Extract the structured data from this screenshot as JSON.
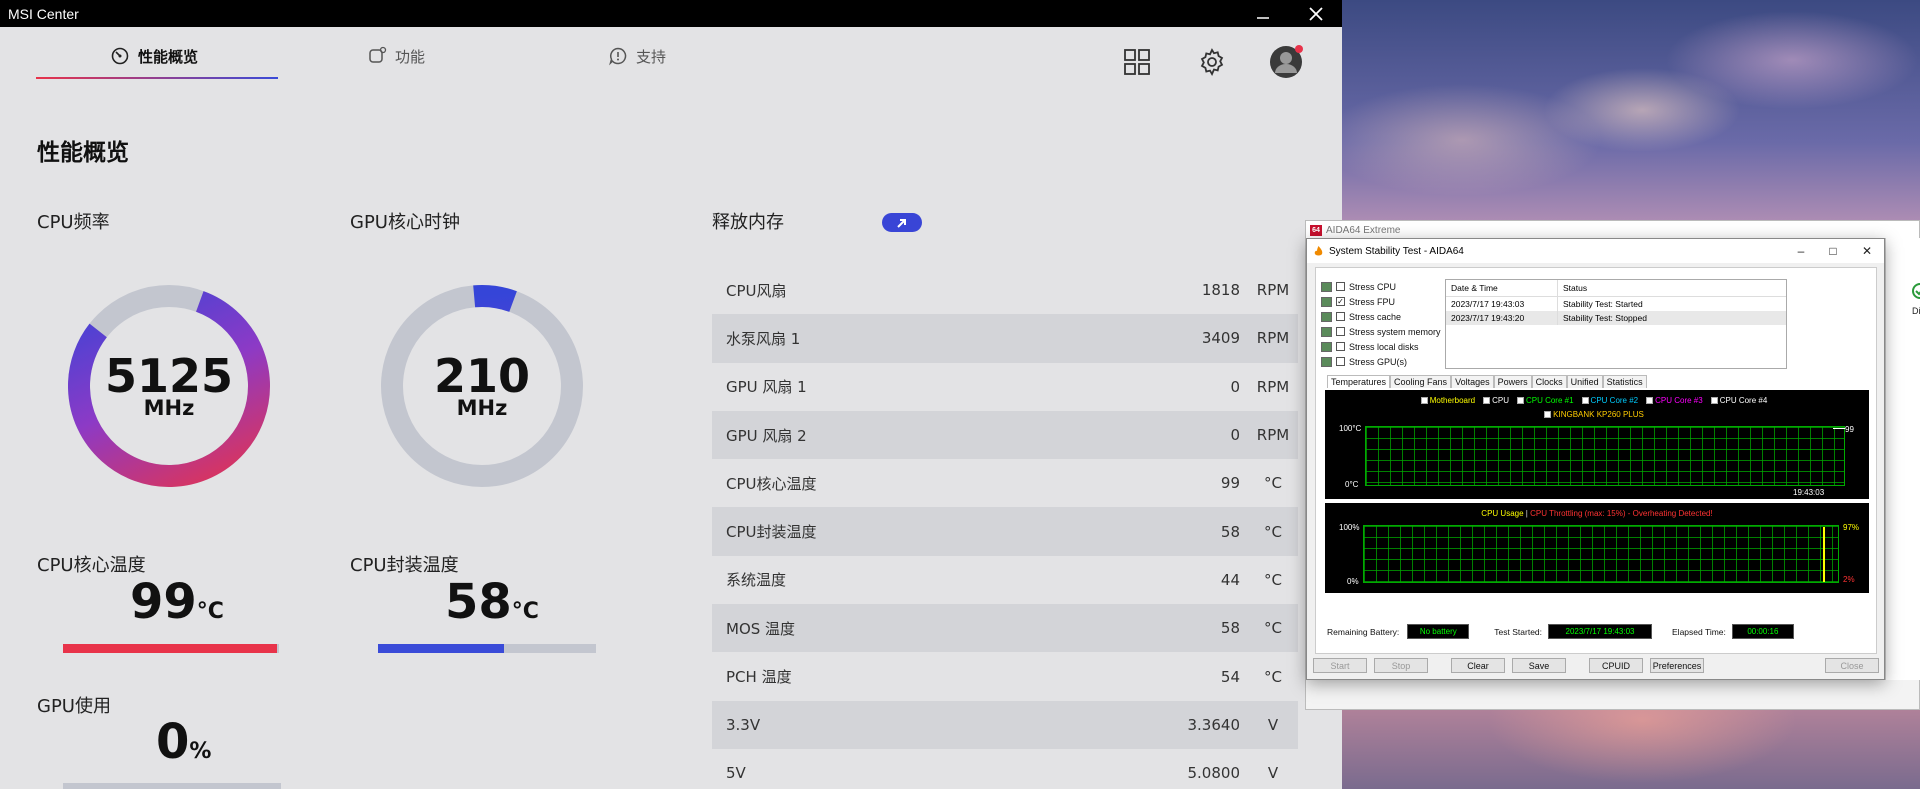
{
  "msi": {
    "title": "MSI Center",
    "tabs": [
      {
        "label": "性能概览"
      },
      {
        "label": "功能"
      },
      {
        "label": "支持"
      }
    ],
    "heading": "性能概览",
    "cpu_freq": {
      "label": "CPU频率",
      "value": "5125",
      "unit": "MHz",
      "fraction": 0.8
    },
    "gpu_clock": {
      "label": "GPU核心时钟",
      "value": "210",
      "unit": "MHz",
      "fraction": 0.07
    },
    "cpu_core_temp": {
      "label": "CPU核心温度",
      "value": "99",
      "unit": "°C",
      "fraction": 0.99,
      "color": "#e8334a"
    },
    "cpu_pkg_temp": {
      "label": "CPU封装温度",
      "value": "58",
      "unit": "°C",
      "fraction": 0.58,
      "color": "#3a4bd8"
    },
    "gpu_usage": {
      "label": "GPU使用",
      "value": "0",
      "unit": "%"
    },
    "release_memory": {
      "label": "释放内存"
    },
    "sensors": [
      {
        "name": "CPU风扇",
        "value": "1818",
        "unit": "RPM"
      },
      {
        "name": "水泵风扇 1",
        "value": "3409",
        "unit": "RPM"
      },
      {
        "name": "GPU 风扇 1",
        "value": "0",
        "unit": "RPM"
      },
      {
        "name": "GPU 风扇 2",
        "value": "0",
        "unit": "RPM"
      },
      {
        "name": "CPU核心温度",
        "value": "99",
        "unit": "°C"
      },
      {
        "name": "CPU封装温度",
        "value": "58",
        "unit": "°C"
      },
      {
        "name": "系统温度",
        "value": "44",
        "unit": "°C"
      },
      {
        "name": "MOS 温度",
        "value": "58",
        "unit": "°C"
      },
      {
        "name": "PCH 温度",
        "value": "54",
        "unit": "°C"
      },
      {
        "name": "3.3V",
        "value": "3.3640",
        "unit": "V"
      },
      {
        "name": "5V",
        "value": "5.0800",
        "unit": "V"
      }
    ]
  },
  "aida": {
    "bg_title": "AIDA64 Extreme",
    "logo": "64",
    "dialog_title": "System Stability Test - AIDA64",
    "checks": [
      {
        "label": "Stress CPU",
        "checked": false
      },
      {
        "label": "Stress FPU",
        "checked": true
      },
      {
        "label": "Stress cache",
        "checked": false
      },
      {
        "label": "Stress system memory",
        "checked": false
      },
      {
        "label": "Stress local disks",
        "checked": false
      },
      {
        "label": "Stress GPU(s)",
        "checked": false
      }
    ],
    "log_headers": {
      "date": "Date & Time",
      "status": "Status"
    },
    "log_rows": [
      {
        "date": "2023/7/17 19:43:03",
        "status": "Stability Test: Started"
      },
      {
        "date": "2023/7/17 19:43:20",
        "status": "Stability Test: Stopped"
      }
    ],
    "graph_tabs": [
      "Temperatures",
      "Cooling Fans",
      "Voltages",
      "Powers",
      "Clocks",
      "Unified",
      "Statistics"
    ],
    "temp_legend": [
      "Motherboard",
      "CPU",
      "CPU Core #1",
      "CPU Core #2",
      "CPU Core #3",
      "CPU Core #4",
      "KINGBANK KP260 PLUS"
    ],
    "temp_graph": {
      "ymax": "100°C",
      "ymin": "0°C",
      "time": "19:43:03",
      "current": "99"
    },
    "usage_graph": {
      "title": "CPU Usage",
      "sep": "|",
      "throttle": "CPU Throttling (max: 15%) - Overheating Detected!",
      "ymax": "100%",
      "ymin": "0%",
      "current": "97%",
      "low": "2%"
    },
    "status": {
      "battery_label": "Remaining Battery:",
      "battery": "No battery",
      "started_label": "Test Started:",
      "started": "2023/7/17 19:43:03",
      "elapsed_label": "Elapsed Time:",
      "elapsed": "00:00:16"
    },
    "buttons": {
      "start": "Start",
      "stop": "Stop",
      "clear": "Clear",
      "save": "Save",
      "cpuid": "CPUID",
      "prefs": "Preferences",
      "close": "Close"
    },
    "side_text": "Di"
  },
  "colors": {
    "accent_red": "#e8334a",
    "accent_blue": "#3a4bd8",
    "graph_green": "#00aa00"
  }
}
